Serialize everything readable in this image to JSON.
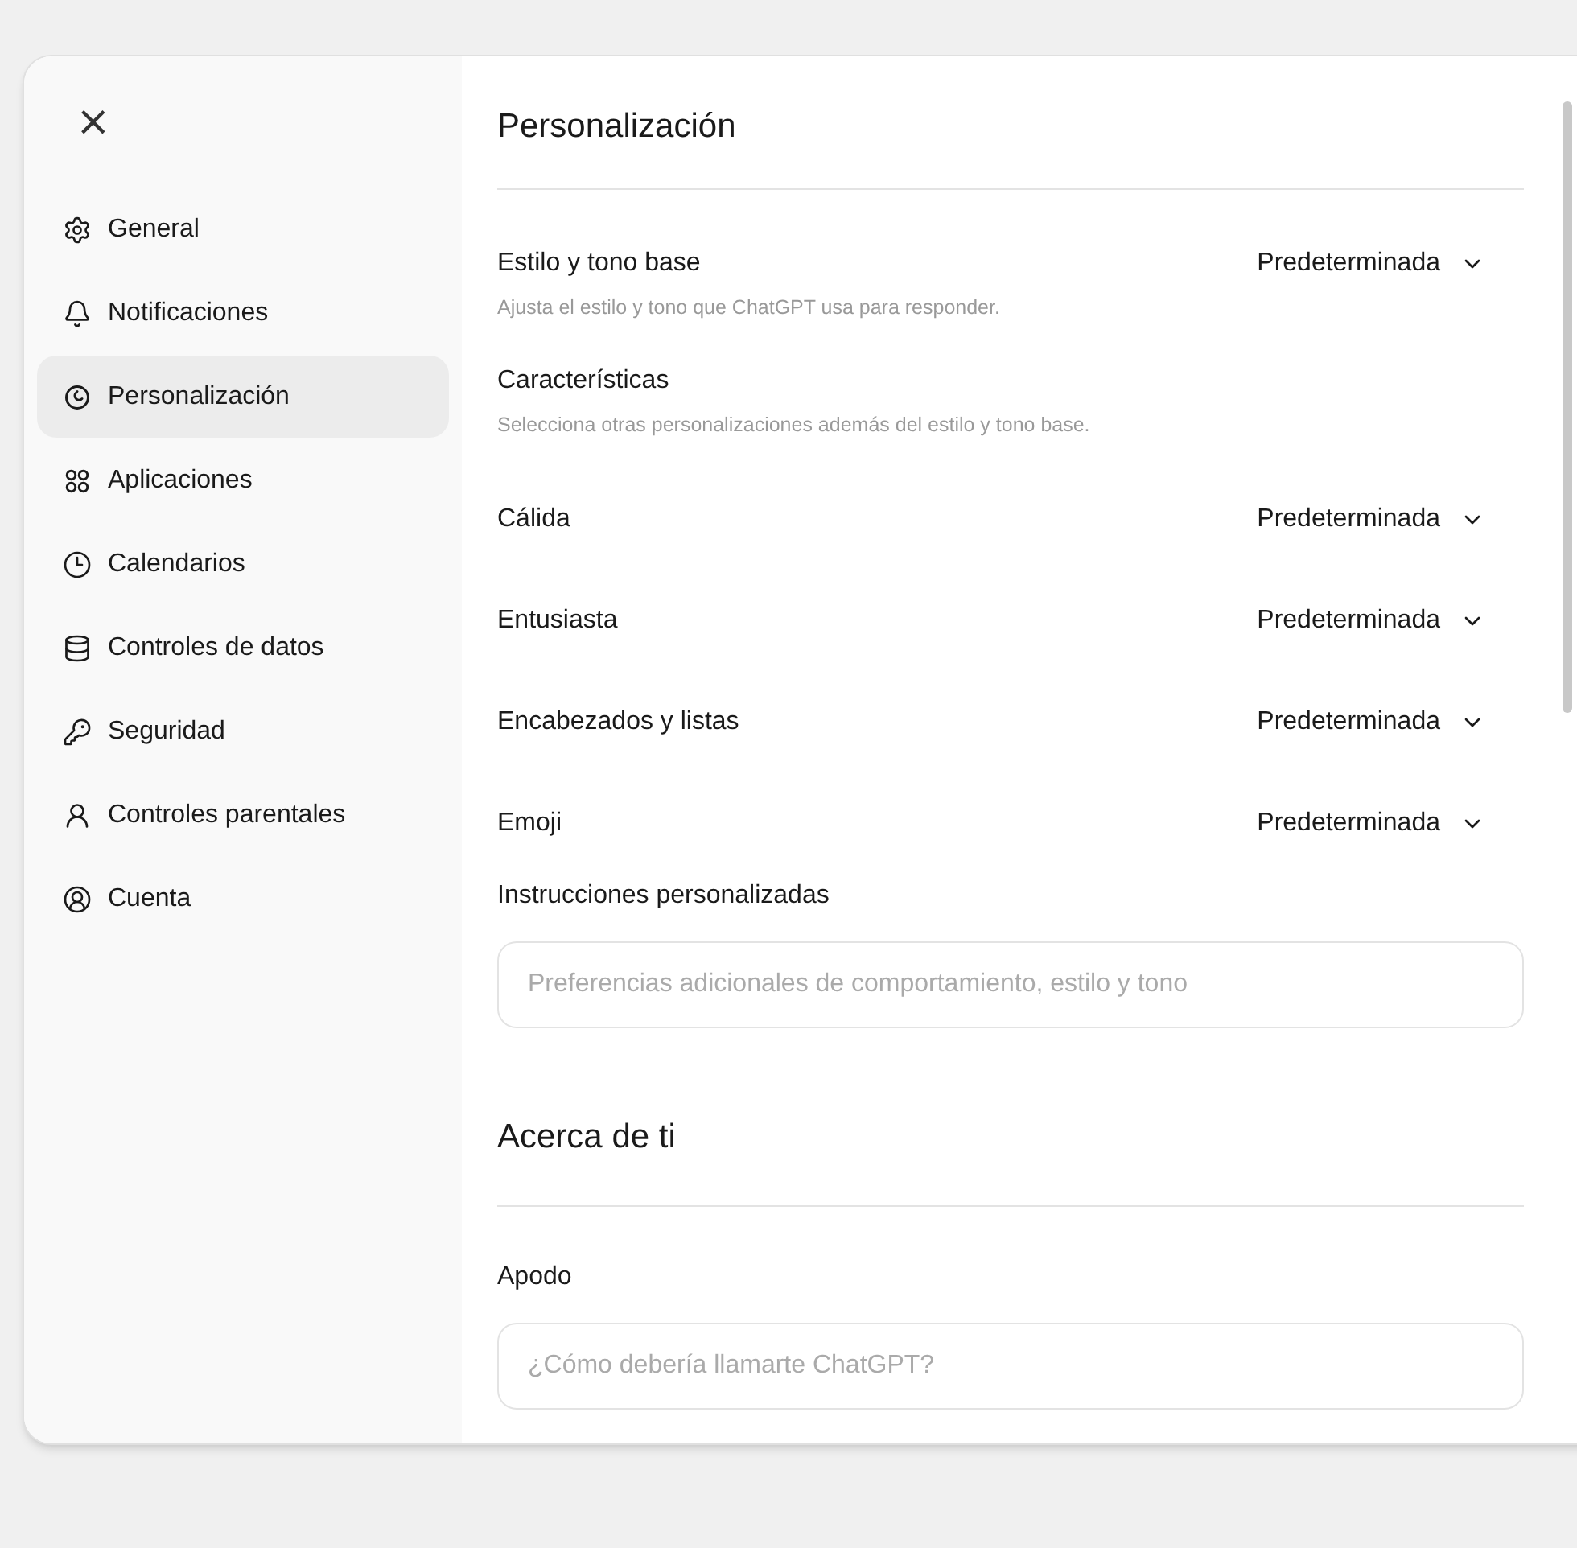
{
  "close_button": {
    "label": "×"
  },
  "sidebar": {
    "items": [
      {
        "label": "General",
        "selected": false
      },
      {
        "label": "Notificaciones",
        "selected": false
      },
      {
        "label": "Personalización",
        "selected": true
      },
      {
        "label": "Aplicaciones",
        "selected": false
      },
      {
        "label": "Calendarios",
        "selected": false
      },
      {
        "label": "Controles de datos",
        "selected": false
      },
      {
        "label": "Seguridad",
        "selected": false
      },
      {
        "label": "Controles parentales",
        "selected": false
      },
      {
        "label": "Cuenta",
        "selected": false
      }
    ]
  },
  "section_title": "Personalización",
  "base_style": {
    "label": "Estilo y tono base",
    "value": "Predeterminada",
    "description": "Ajusta el estilo y tono que ChatGPT usa para responder."
  },
  "characteristics": {
    "title": "Características",
    "description": "Selecciona otras personalizaciones además del estilo y tono base.",
    "rows": [
      {
        "label": "Cálida",
        "value": "Predeterminada"
      },
      {
        "label": "Entusiasta",
        "value": "Predeterminada"
      },
      {
        "label": "Encabezados y listas",
        "value": "Predeterminada"
      },
      {
        "label": "Emoji",
        "value": "Predeterminada"
      }
    ]
  },
  "custom_instructions": {
    "label": "Instrucciones personalizadas",
    "placeholder": "Preferencias adicionales de comportamiento, estilo y tono"
  },
  "about_title": "Acerca de ti",
  "nickname": {
    "label": "Apodo",
    "placeholder": "¿Cómo debería llamarte ChatGPT?"
  }
}
